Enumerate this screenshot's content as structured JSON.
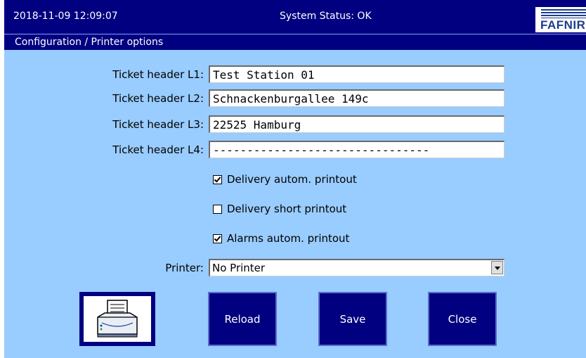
{
  "header": {
    "datetime": "2018-11-09  12:09:07",
    "status": "System Status: OK",
    "logo_text": "FAFNIR"
  },
  "breadcrumb": "Configuration / Printer options",
  "fields": [
    {
      "label": "Ticket header L1:",
      "value": "Test Station 01"
    },
    {
      "label": "Ticket header L2:",
      "value": "Schnackenburgallee 149c"
    },
    {
      "label": "Ticket header L3:",
      "value": "22525 Hamburg"
    },
    {
      "label": "Ticket header L4:",
      "value": "--------------------------------"
    }
  ],
  "checkboxes": [
    {
      "label": "Delivery autom. printout",
      "checked": true
    },
    {
      "label": "Delivery short printout",
      "checked": false
    },
    {
      "label": "Alarms autom. printout",
      "checked": true
    }
  ],
  "printer": {
    "label": "Printer:",
    "value": "No Printer"
  },
  "buttons": {
    "print_icon": "printer-icon",
    "reload": "Reload",
    "save": "Save",
    "close": "Close"
  },
  "colors": {
    "navy": "#000080",
    "background": "#99ccff"
  }
}
